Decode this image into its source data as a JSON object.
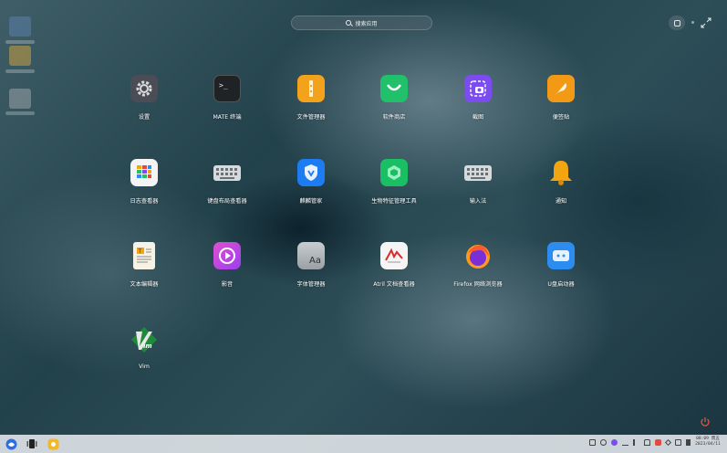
{
  "search": {
    "placeholder": "搜索应用"
  },
  "apps": [
    {
      "name": "settings",
      "label": "设置",
      "icon": "gear-icon",
      "color": "#4a4d55"
    },
    {
      "name": "mate-terminal",
      "label": "MATE 终端",
      "icon": "terminal-icon",
      "color": "#1f2326"
    },
    {
      "name": "file-manager",
      "label": "文件管理器",
      "icon": "folder-zip-icon",
      "color": "#f3a21c"
    },
    {
      "name": "software-store",
      "label": "软件商店",
      "icon": "shopping-bag-icon",
      "color": "#21c06a"
    },
    {
      "name": "screenshot",
      "label": "截图",
      "icon": "camera-icon",
      "color": "#7b4df0"
    },
    {
      "name": "notes",
      "label": "便签贴",
      "icon": "feather-icon",
      "color": "#f29a15"
    },
    {
      "name": "log-viewer",
      "label": "日志查看器",
      "icon": "grid-log-icon",
      "color": "#f4f4f4"
    },
    {
      "name": "keyboard-layout-viewer",
      "label": "键盘布局查看器",
      "icon": "keyboard-icon",
      "color": "#cfd3d6"
    },
    {
      "name": "security-center",
      "label": "麒麟管家",
      "icon": "shield-icon",
      "color": "#1d7cf2"
    },
    {
      "name": "biometric-manager",
      "label": "生物特征管理工具",
      "icon": "cube-icon",
      "color": "#1bbf63"
    },
    {
      "name": "input-method",
      "label": "输入法",
      "icon": "keyboard-icon",
      "color": "#cfd3d6"
    },
    {
      "name": "notifications",
      "label": "通知",
      "icon": "bell-icon",
      "color": "#f2a411"
    },
    {
      "name": "text-editor",
      "label": "文本编辑器",
      "icon": "text-editor-icon",
      "color": "#f7f3e4"
    },
    {
      "name": "video-player",
      "label": "影音",
      "icon": "play-icon",
      "color": "#c93fd9"
    },
    {
      "name": "font-manager",
      "label": "字体管理器",
      "icon": "font-aa-icon",
      "color": "#b9bec2"
    },
    {
      "name": "atril-viewer",
      "label": "Atril 文档查看器",
      "icon": "document-icon",
      "color": "#f5f5f5"
    },
    {
      "name": "firefox",
      "label": "Firefox 网络浏览器",
      "icon": "firefox-icon",
      "color": "#e8512a"
    },
    {
      "name": "usb-boot-creator",
      "label": "U盘启动器",
      "icon": "usb-icon",
      "color": "#2d8cf0"
    },
    {
      "name": "vim",
      "label": "Vim",
      "icon": "vim-icon",
      "color": "#1f8a3a"
    }
  ],
  "clock": {
    "time": "08:09 周五",
    "date": "2023/04/11"
  }
}
